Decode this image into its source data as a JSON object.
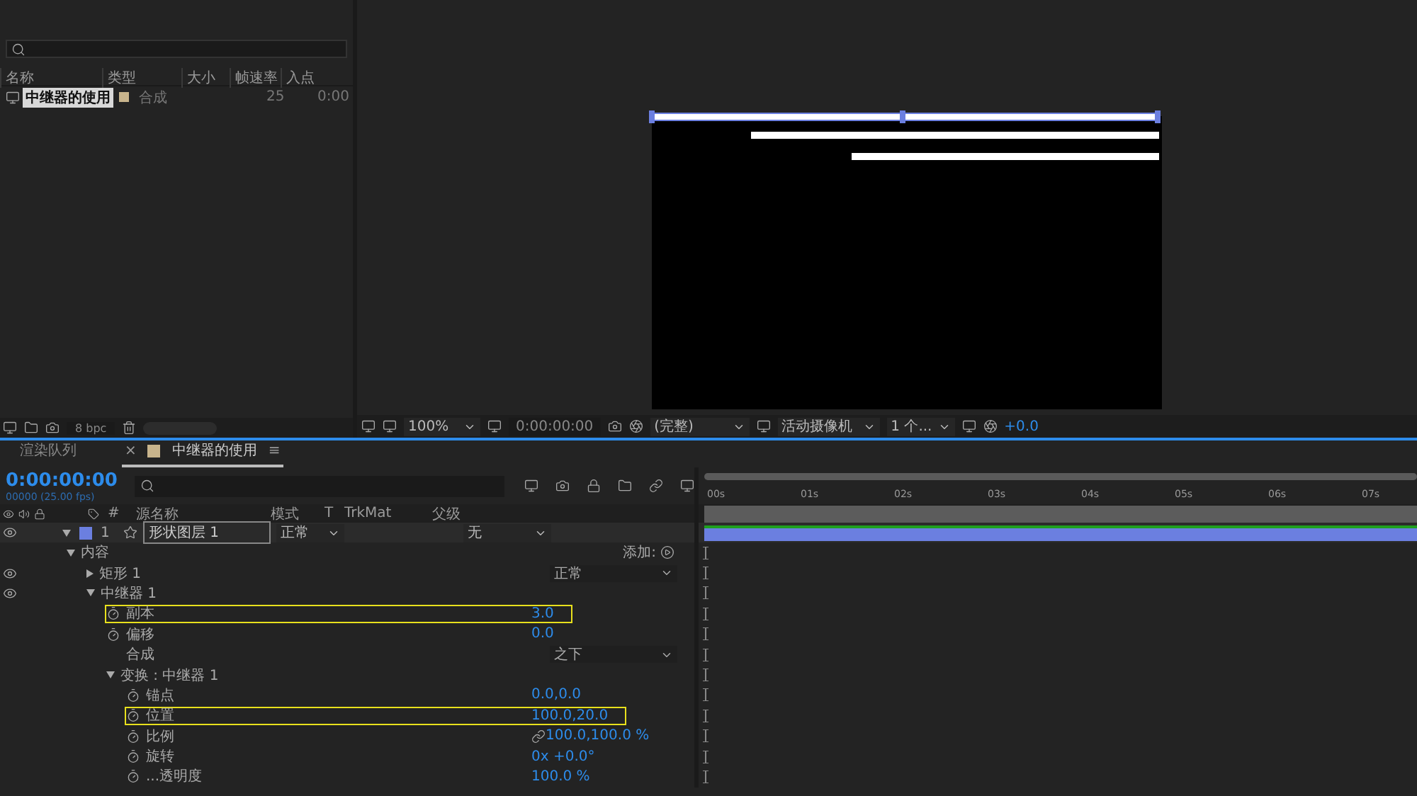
{
  "project": {
    "columns": [
      "名称",
      "类型",
      "大小",
      "帧速率",
      "入点"
    ],
    "items": [
      {
        "name": "中继器的使用",
        "type": "合成",
        "fps": "25",
        "in": "0:00",
        "selected": true,
        "color": "#c8b48c"
      }
    ],
    "bpc": "8 bpc"
  },
  "viewer": {
    "zoom": "100%",
    "timecode": "0:00:00:00",
    "resolution": "(完整)",
    "camera": "活动摄像机",
    "views": "1 个...",
    "exposure": "+0.0"
  },
  "tabs": [
    {
      "label": "渲染队列",
      "selected": false
    },
    {
      "label": "中继器的使用",
      "selected": true,
      "close": "×",
      "menu": "≡",
      "color": "#c8b48c"
    }
  ],
  "timeline": {
    "timecode": "0:00:00:00",
    "fps": "00000 (25.00 fps)",
    "columns": [
      "#",
      "源名称",
      "模式",
      "T",
      "TrkMat",
      "父级"
    ],
    "ruler": [
      "00s",
      "01s",
      "02s",
      "03s",
      "04s",
      "05s",
      "06s",
      "07s"
    ],
    "layer": {
      "index": "1",
      "name": "形状图层 1",
      "mode": "正常",
      "parent": "无",
      "color": "#6b7fe0",
      "expanded": true
    },
    "tree": [
      {
        "label": "内容",
        "kind": "group",
        "expanded": true,
        "add": "添加:",
        "children": [
          {
            "label": "矩形 1",
            "kind": "group",
            "expanded": false,
            "visible": true,
            "dropdown": "正常"
          },
          {
            "label": "中继器 1",
            "kind": "group",
            "expanded": true,
            "visible": true,
            "children": [
              {
                "label": "副本",
                "kind": "property",
                "value": "3.0",
                "highlighted": true
              },
              {
                "label": "偏移",
                "kind": "property",
                "value": "0.0",
                "highlighted": false
              },
              {
                "label": "合成",
                "kind": "option",
                "dropdown": "之下"
              },
              {
                "label": "变换 : 中继器 1",
                "kind": "group",
                "expanded": true,
                "children": [
                  {
                    "label": "锚点",
                    "kind": "property",
                    "value": "0.0,0.0",
                    "highlighted": false
                  },
                  {
                    "label": "位置",
                    "kind": "property",
                    "value": "100.0,20.0",
                    "highlighted": true
                  },
                  {
                    "label": "比例",
                    "kind": "property",
                    "value": "100.0,100.0 %",
                    "highlighted": false,
                    "linked": true
                  },
                  {
                    "label": "旋转",
                    "kind": "property",
                    "value": "0x +0.0°",
                    "highlighted": false
                  },
                  {
                    "label": "...透明度",
                    "kind": "property",
                    "value": "100.0 %",
                    "highlighted": false
                  }
                ]
              }
            ]
          }
        ]
      }
    ]
  }
}
